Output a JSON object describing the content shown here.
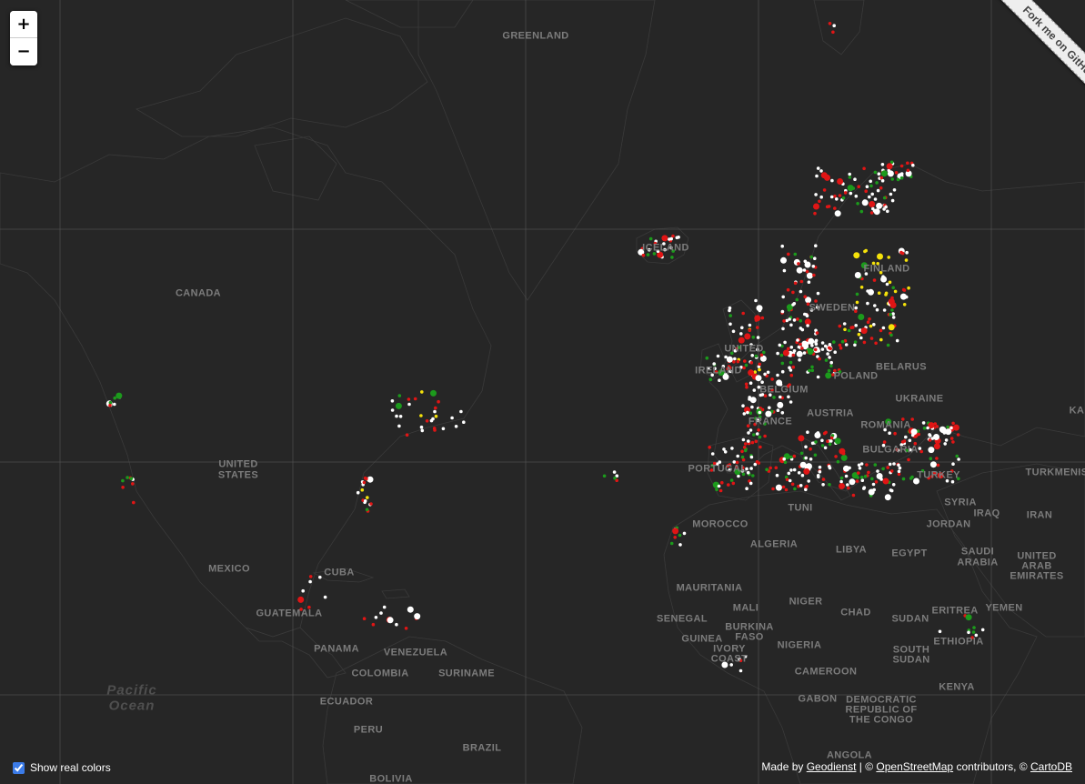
{
  "map": {
    "zoom_in_label": "+",
    "zoom_out_label": "−",
    "ribbon_text": "Fork me on GitHub",
    "show_colors_label": "Show real colors",
    "show_colors_checked": true,
    "attribution": {
      "prefix": "Made by ",
      "geodienst": "Geodienst",
      "sep1": " | © ",
      "osm": "OpenStreetMap",
      "sep2": " contributors, © ",
      "carto": "CartoDB"
    },
    "colors": {
      "land": "#0f0f0f",
      "ocean": "#262626",
      "label": "#7c7c7c",
      "dot_white": "#ffffff",
      "dot_red": "#e01515",
      "dot_green": "#1c9a1c",
      "dot_yellow": "#f5e20a"
    },
    "labels": {
      "greenland": "GREENLAND",
      "iceland": "ICELAND",
      "canada": "CANADA",
      "united_states_1": "UNITED",
      "united_states_2": "STATES",
      "mexico": "MEXICO",
      "cuba": "CUBA",
      "guatemala": "GUATEMALA",
      "panama": "PANAMA",
      "venezuela": "VENEZUELA",
      "colombia": "COLOMBIA",
      "suriname": "SURINAME",
      "ecuador": "ECUADOR",
      "peru": "PERU",
      "brazil": "BRAZIL",
      "pacific_1": "Pacific",
      "pacific_2": "Ocean",
      "sweden": "SWEDEN",
      "finland": "FINLAND",
      "united_kingdom": "UNITED",
      "ireland": "IRELAND",
      "belgium": "BELGIUM",
      "france": "FRANCE",
      "poland": "POLAND",
      "belarus": "BELARUS",
      "ukraine": "UKRAINE",
      "austria": "AUSTRIA",
      "romania": "ROMANIA",
      "bulgaria": "BULGARIA",
      "portugal": "PORTUGAL",
      "turkey": "TURKEY",
      "turkmenistan": "TURKMENIS",
      "syria": "SYRIA",
      "iraq": "IRAQ",
      "iran": "IRAN",
      "kazakhstan": "KA",
      "tunisia": "TUNI",
      "morocco": "MOROCCO",
      "algeria": "ALGERIA",
      "libya": "LIBYA",
      "egypt": "EGYPT",
      "jordan": "JORDAN",
      "saudi_1": "SAUDI",
      "saudi_2": "ARABIA",
      "uae_1": "UNITED",
      "uae_2": "ARAB",
      "uae_3": "EMIRATES",
      "yemen": "YEMEN",
      "eritrea": "ERITREA",
      "mauritania": "MAURITANIA",
      "mali": "MALI",
      "niger": "NIGER",
      "chad": "CHAD",
      "sudan": "SUDAN",
      "senegal": "SENEGAL",
      "guinea": "GUINEA",
      "burkina_1": "BURKINA",
      "burkina_2": "FASO",
      "ivory_1": "IVORY",
      "ivory_2": "COAST",
      "nigeria": "NIGERIA",
      "ethiopia": "ETHIOPIA",
      "south_sudan_1": "SOUTH",
      "south_sudan_2": "SUDAN",
      "cameroon": "CAMEROON",
      "gabon": "GABON",
      "drc_1": "DEMOCRATIC",
      "drc_2": "REPUBLIC OF",
      "drc_3": "THE CONGO",
      "kenya": "KENYA",
      "angola": "ANGOLA",
      "bolivia": "BOLIVIA"
    }
  }
}
